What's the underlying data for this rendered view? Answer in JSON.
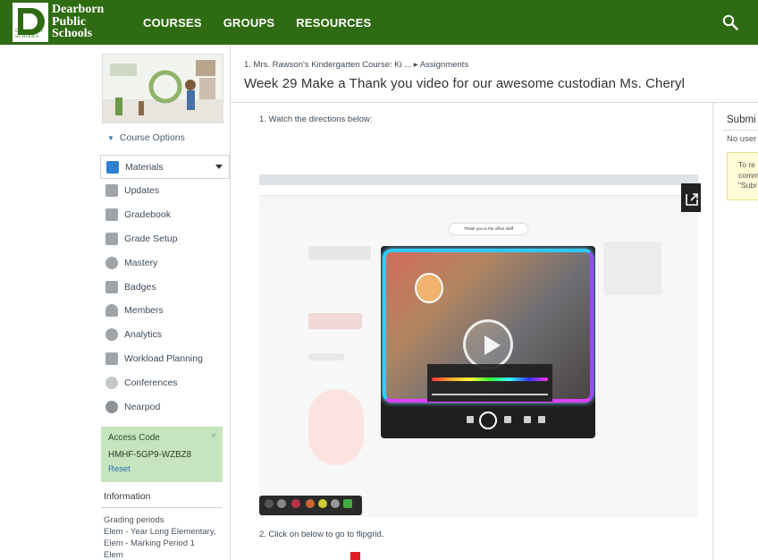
{
  "header": {
    "logo_lines": [
      "Dearborn",
      "Public",
      "Schools"
    ],
    "logo_sub": "DEARBORN SCHOOLS",
    "nav": [
      "COURSES",
      "GROUPS",
      "RESOURCES"
    ],
    "icon": "search-icon",
    "color": "#2e6b12"
  },
  "sidebar": {
    "course_options": "Course Options",
    "menu": [
      {
        "label": "Materials",
        "icon": "materials-icon",
        "active": true
      },
      {
        "label": "Updates",
        "icon": "updates-icon"
      },
      {
        "label": "Gradebook",
        "icon": "gradebook-icon"
      },
      {
        "label": "Grade Setup",
        "icon": "grade-setup-icon"
      },
      {
        "label": "Mastery",
        "icon": "mastery-icon"
      },
      {
        "label": "Badges",
        "icon": "badges-icon"
      },
      {
        "label": "Members",
        "icon": "members-icon"
      },
      {
        "label": "Analytics",
        "icon": "analytics-icon"
      },
      {
        "label": "Workload Planning",
        "icon": "workload-icon"
      },
      {
        "label": "Conferences",
        "icon": "conferences-icon"
      },
      {
        "label": "Nearpod",
        "icon": "nearpod-icon"
      }
    ],
    "access_code": {
      "title": "Access Code",
      "code": "HMHF-5GP9-WZBZ8",
      "reset": "Reset",
      "close": "×"
    },
    "information": {
      "title": "Information",
      "lines": [
        "Grading periods",
        "Elem - Year Long Elementary,",
        "Elem - Marking Period 1",
        "Elem"
      ]
    }
  },
  "main": {
    "breadcrumb_course": "1. Mrs. Rawson's Kindergarten Course: Ki ...",
    "breadcrumb_sep": "▸",
    "breadcrumb_page": "Assignments",
    "title": "Week 29 Make a Thank you video for our awesome custodian Ms. Cheryl",
    "step1": "1. Watch the directions below:",
    "step2": "2. Click on below to go to flipgrid.",
    "video_caption": "Thank you to the office staff"
  },
  "right": {
    "title": "Submi",
    "subtitle": "No user",
    "notice": [
      "To re",
      "comm",
      "\"Subr"
    ]
  }
}
